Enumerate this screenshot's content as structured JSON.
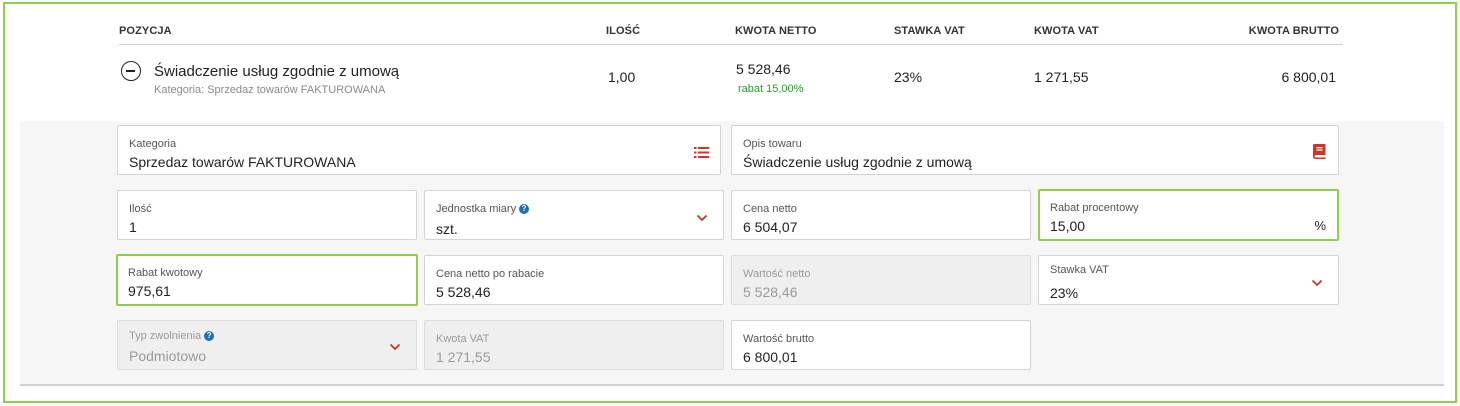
{
  "table": {
    "headers": {
      "pozycja": "POZYCJA",
      "ilosc": "ILOŚĆ",
      "kwota_netto": "KWOTA NETTO",
      "stawka_vat": "STAWKA VAT",
      "kwota_vat": "KWOTA VAT",
      "kwota_brutto": "KWOTA BRUTTO"
    },
    "row": {
      "name": "Świadczenie usług zgodnie z umową",
      "category": "Kategoria: Sprzedaz towarów FAKTUROWANA",
      "ilosc": "1,00",
      "kwota_netto": "5 528,46",
      "rabat": "rabat 15,00%",
      "stawka_vat": "23%",
      "kwota_vat": "1 271,55",
      "kwota_brutto": "6 800,01"
    }
  },
  "form": {
    "kategoria": {
      "label": "Kategoria",
      "value": "Sprzedaz towarów FAKTUROWANA"
    },
    "opis": {
      "label": "Opis towaru",
      "value": "Świadczenie usług zgodnie z umową"
    },
    "ilosc": {
      "label": "Ilość",
      "value": "1"
    },
    "jednostka": {
      "label": "Jednostka miary",
      "value": "szt.",
      "help": "?"
    },
    "cena_netto": {
      "label": "Cena netto",
      "value": "6 504,07"
    },
    "rabat_proc": {
      "label": "Rabat procentowy",
      "value": "15,00",
      "suffix": "%"
    },
    "rabat_kwot": {
      "label": "Rabat kwotowy",
      "value": "975,61"
    },
    "cena_po_rabacie": {
      "label": "Cena netto po rabacie",
      "value": "5 528,46"
    },
    "wartosc_netto": {
      "label": "Wartość netto",
      "value": "5 528,46"
    },
    "stawka_vat": {
      "label": "Stawka VAT",
      "value": "23%"
    },
    "typ_zwolnienia": {
      "label": "Typ zwolnienia",
      "value": "Podmiotowo",
      "help": "?"
    },
    "kwota_vat": {
      "label": "Kwota VAT",
      "value": "1 271,55"
    },
    "wartosc_brutto": {
      "label": "Wartość brutto",
      "value": "6 800,01"
    }
  },
  "colors": {
    "highlight": "#8dd04a",
    "accent_red": "#d0342c",
    "help_blue": "#1f6fb8",
    "discount_green": "#2e9a2e"
  },
  "icons": {
    "collapse": "minus-circle-icon",
    "category": "list-icon",
    "description": "book-icon",
    "dropdown": "chevron-down-icon",
    "help": "help-icon"
  }
}
